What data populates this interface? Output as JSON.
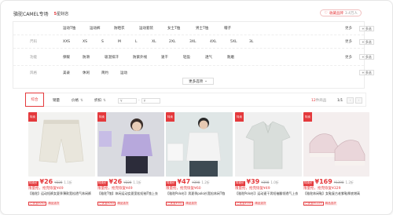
{
  "header": {
    "brand_name": "骆驼CAMEL专场",
    "rating_value": "5",
    "rating_suffix": "星好店",
    "fav_label": "收藏品牌",
    "fav_count": "3.4万人"
  },
  "filters": {
    "rows": [
      {
        "label": "",
        "options": [
          "运动T恤",
          "运动裤",
          "防晒衣",
          "运动套装",
          "女士T恤",
          "男士T恤",
          "帽子"
        ],
        "more": "更多",
        "multi": "+ 多选"
      },
      {
        "label": "尺码",
        "options": [
          "XXS",
          "XS",
          "S",
          "M",
          "L",
          "XL",
          "2XL",
          "3XL",
          "4XL",
          "5XL",
          "3L"
        ],
        "more": "更多",
        "multi": "+ 多选"
      },
      {
        "label": "功能",
        "options": [
          "保暖",
          "防滑",
          "吸湿排汗",
          "防紫外线",
          "速干",
          "轻盈",
          "透气",
          "耐磨"
        ],
        "more": "更多",
        "multi": "+ 多选"
      },
      {
        "label": "风格",
        "options": [
          "美录",
          "休闲",
          "简约",
          "运动"
        ],
        "more": "",
        "multi": "+ 多选"
      }
    ],
    "more_options_label": "更多选项"
  },
  "toolbar": {
    "sort_default": "综合",
    "sort_sales": "销量",
    "sort_price": "价格",
    "sort_discount": "折扣",
    "price_min_placeholder": "¥",
    "price_max_placeholder": "¥",
    "count_prefix": "",
    "count_value": "12",
    "count_suffix": "件商品",
    "page": "1/1",
    "prev": "‹",
    "next": "›"
  },
  "products": [
    {
      "badge": "特卖",
      "price_tag": "特卖价",
      "price": "¥26",
      "old_price": "¥228",
      "discount": "1.1折",
      "coupon": "限量抢，抢完恢复¥49",
      "title": "【骆驼】运动短裤女夏季薄款宽松透气休闲裤",
      "tag1": "已优惠¥202",
      "tag2": "精品选货",
      "thumb_colors": [
        "#6b6bd6",
        "#8888aa"
      ],
      "img_bg": "#f2f2f0",
      "img_main": "#e9e6dc"
    },
    {
      "badge": "特卖",
      "price_tag": "特卖价",
      "price": "¥26",
      "old_price": "¥228",
      "discount": "1.1折",
      "coupon": "限量抢，抢完恢复¥49",
      "title": "【骆驼T恤】休闲运动女夏宽松短袖T恤上衣",
      "tag1": "已优惠¥202",
      "tag2": "精品选货",
      "thumb_colors": [
        "#b9a9e0",
        "#d8d8d8"
      ],
      "img_bg": "#dcdce2",
      "img_main": "#b7a8dc"
    },
    {
      "badge": "特卖",
      "price_tag": "特卖价",
      "price": "¥47",
      "old_price": "¥398",
      "discount": "1.2折",
      "coupon": "限量抢，抢完恢复¥60",
      "title": "【骆驼Polo衫】男夏季polo衫宽松休闲T恤",
      "tag1": "已优惠¥351",
      "tag2": "精品选货",
      "thumb_colors": [
        "#e8e8e8",
        "#c8d8e8"
      ],
      "img_bg": "#dfe6e6",
      "img_main": "#f3f3f3"
    },
    {
      "badge": "特卖",
      "price_tag": "特卖价",
      "price": "¥39",
      "old_price": "¥398",
      "discount": "1.0折",
      "coupon": "限量抢，抢完恢复¥49",
      "title": "【骆驼Polo衫】运动速干男短袖翻领透气上衣",
      "tag1": "已优惠¥359",
      "tag2": "精品选货",
      "thumb_colors": [
        "#9aa4a0",
        "#d8e0e6"
      ],
      "img_bg": "#f0f0f0",
      "img_main": "#d9dedb"
    },
    {
      "badge": "特卖",
      "price_tag": "特卖价",
      "price": "¥169",
      "old_price": "¥1398",
      "discount": "1.2折",
      "coupon": "限量抢，抢完恢复¥329",
      "title": "【骆驼休闲鞋】女鞋复古老爹鞋厚底增高",
      "tag1": "已优惠¥1229",
      "tag2": "精品选货",
      "thumb_colors": [
        "#e0b8c8",
        "#ffffff"
      ],
      "img_bg": "#f4eeee",
      "img_main": "#ead6da"
    }
  ],
  "colors": {
    "accent": "#e4393c",
    "muted": "#999999"
  }
}
